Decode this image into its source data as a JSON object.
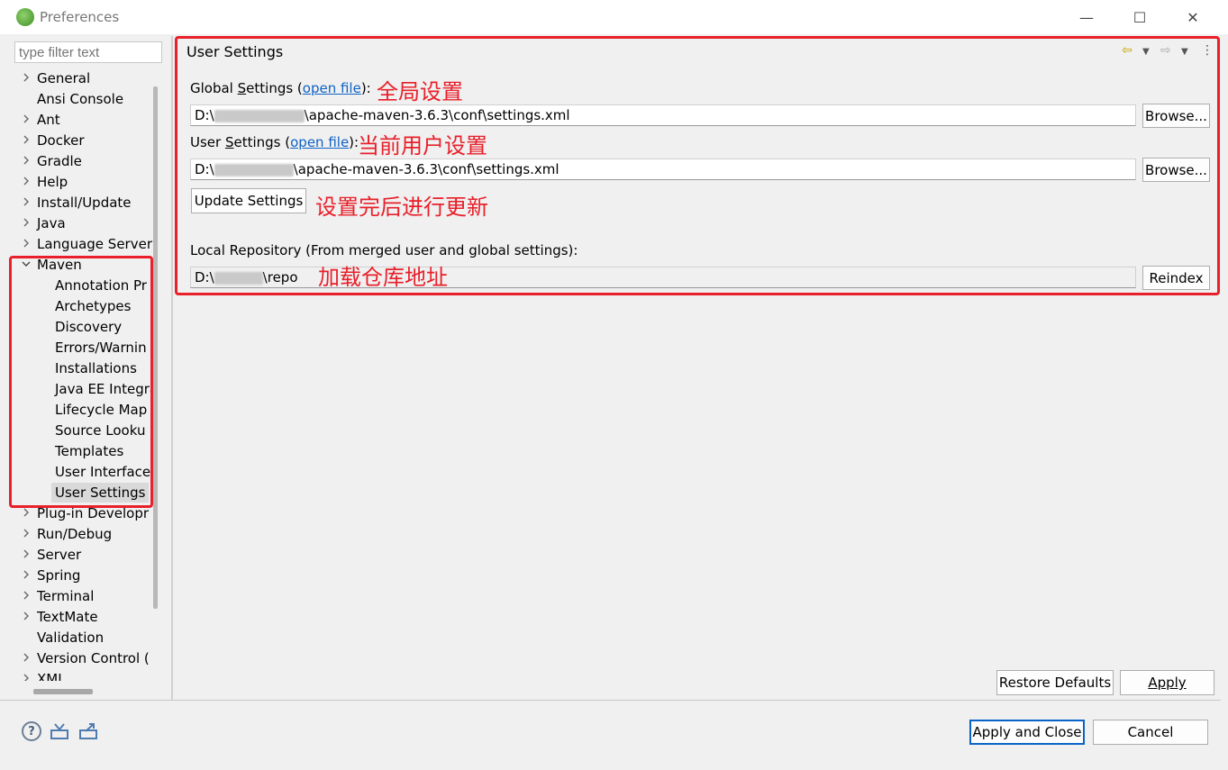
{
  "window": {
    "title": "Preferences",
    "minimize_glyph": "—",
    "maximize_glyph": "☐",
    "close_glyph": "✕"
  },
  "filter": {
    "placeholder": "type filter text"
  },
  "tree": {
    "items": [
      {
        "label": "General",
        "expandable": true
      },
      {
        "label": "Ansi Console",
        "expandable": false
      },
      {
        "label": "Ant",
        "expandable": true
      },
      {
        "label": "Docker",
        "expandable": true
      },
      {
        "label": "Gradle",
        "expandable": true
      },
      {
        "label": "Help",
        "expandable": true
      },
      {
        "label": "Install/Update",
        "expandable": true
      },
      {
        "label": "Java",
        "expandable": true
      },
      {
        "label": "Language Server",
        "expandable": true
      },
      {
        "label": "Maven",
        "expandable": true,
        "expanded": true
      },
      {
        "label": "Annotation Pr",
        "child": true
      },
      {
        "label": "Archetypes",
        "child": true
      },
      {
        "label": "Discovery",
        "child": true
      },
      {
        "label": "Errors/Warnin",
        "child": true
      },
      {
        "label": "Installations",
        "child": true
      },
      {
        "label": "Java EE Integra",
        "child": true
      },
      {
        "label": "Lifecycle Map",
        "child": true
      },
      {
        "label": "Source Looku",
        "child": true
      },
      {
        "label": "Templates",
        "child": true
      },
      {
        "label": "User Interface",
        "child": true
      },
      {
        "label": "User Settings",
        "child": true,
        "selected": true
      },
      {
        "label": "Plug-in Developr",
        "expandable": true
      },
      {
        "label": "Run/Debug",
        "expandable": true
      },
      {
        "label": "Server",
        "expandable": true
      },
      {
        "label": "Spring",
        "expandable": true
      },
      {
        "label": "Terminal",
        "expandable": true
      },
      {
        "label": "TextMate",
        "expandable": true
      },
      {
        "label": "Validation",
        "expandable": false
      },
      {
        "label": "Version Control (",
        "expandable": true
      },
      {
        "label": "XML",
        "expandable": true
      }
    ]
  },
  "page": {
    "title": "User Settings",
    "global": {
      "label_prefix": "Global ",
      "label_mnemonic": "S",
      "label_rest": "ettings (",
      "link": "open file",
      "label_suffix": "):",
      "path_start": "D:\\",
      "path_end": "\\apache-maven-3.6.3\\conf\\settings.xml",
      "annotation": "全局设置"
    },
    "user": {
      "label_prefix": "User ",
      "label_mnemonic": "S",
      "label_rest": "ettings (",
      "link": "open file",
      "label_suffix": "):",
      "path_start": "D:\\",
      "path_end": "\\apache-maven-3.6.3\\conf\\settings.xml",
      "annotation": "当前用户设置"
    },
    "update_button": "Update Settings",
    "update_annotation": "设置完后进行更新",
    "local_repo_label": "Local Repository (From merged user and global settings):",
    "local_repo_start": "D:\\",
    "local_repo_end": "\\repo",
    "local_repo_annotation": "加载仓库地址",
    "browse_label": "Browse...",
    "reindex_label": "Reindex",
    "restore_defaults": "Restore Defaults",
    "apply": "Apply"
  },
  "footer": {
    "apply_and_close": "Apply and Close",
    "cancel": "Cancel"
  },
  "colors": {
    "annotation_red": "#e8202a",
    "link_blue": "#0f62c4",
    "default_button_border": "#0a64c8"
  }
}
